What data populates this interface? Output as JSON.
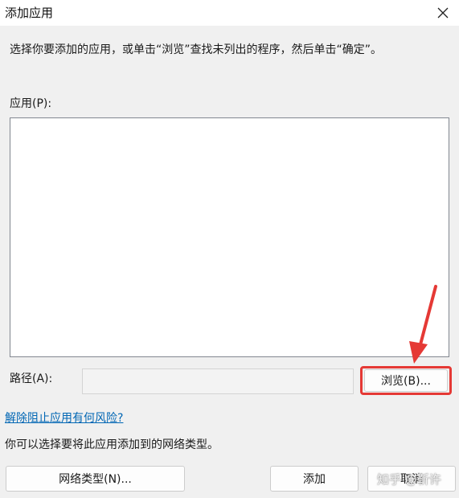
{
  "window": {
    "title": "添加应用",
    "close_icon": "close-icon"
  },
  "instruction": "选择你要添加的应用，或单击“浏览”查找未列出的程序，然后单击“确定”。",
  "apps": {
    "label": "应用(P):",
    "items": []
  },
  "path": {
    "label": "路径(A):",
    "value": "",
    "browse_label": "浏览(B)..."
  },
  "risk_link": "解除阻止应用有何风险?",
  "network_note": "你可以选择要将此应用添加到的网络类型。",
  "buttons": {
    "network_types": "网络类型(N)...",
    "add": "添加",
    "cancel": "取消"
  },
  "annotation": {
    "highlight_color": "#e53935"
  },
  "watermark": "知乎 @靳许"
}
